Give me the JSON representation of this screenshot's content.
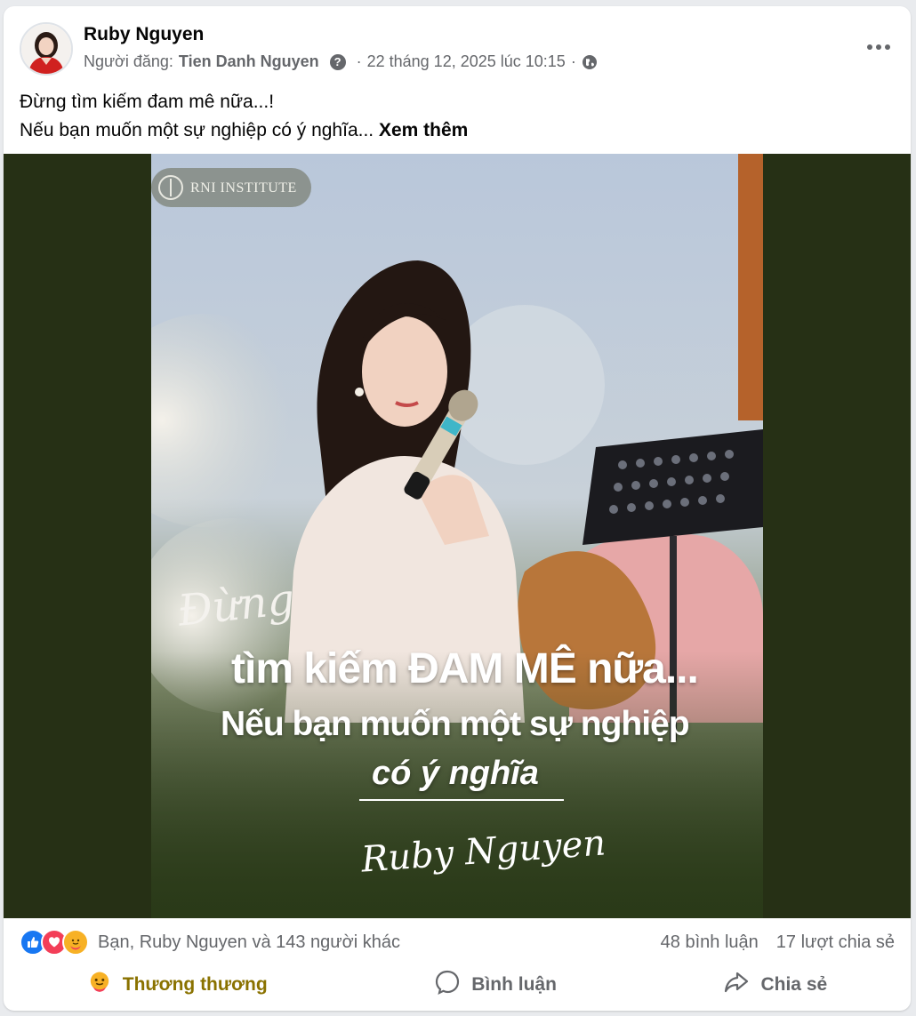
{
  "post": {
    "author": "Ruby Nguyen",
    "poster_prefix": "Người đăng:",
    "poster_name": "Tien Danh Nguyen",
    "separator": "·",
    "timestamp": "22 tháng 12, 2025 lúc 10:15",
    "audience_icon": "globe-icon",
    "text_line1": "Đừng tìm kiếm đam mê nữa...!",
    "text_line2": "Nếu bạn muốn một sự nghiệp có ý nghĩa...",
    "see_more": "Xem thêm"
  },
  "image": {
    "badge": "RNI INSTITUTE",
    "script_word": "Đừng",
    "line1": "tìm kiếm ĐAM MÊ nữa...",
    "line2": "Nếu bạn muốn một sự nghiệp",
    "line3": "có ý nghĩa",
    "signature": "Ruby Nguyen"
  },
  "stats": {
    "reactions_text": "Bạn, Ruby Nguyen và 143 người khác",
    "comments": "48 bình luận",
    "shares": "17 lượt chia sẻ",
    "reaction_icons": [
      "like-icon",
      "love-icon",
      "care-icon"
    ]
  },
  "actions": {
    "care_label": "Thương thương",
    "comment_label": "Bình luận",
    "share_label": "Chia sẻ"
  },
  "colors": {
    "media_bg": "#263015",
    "like_blue": "#1877f2",
    "love_red": "#f33e58",
    "care_yellow": "#f7b125",
    "care_label": "#8a7200"
  }
}
